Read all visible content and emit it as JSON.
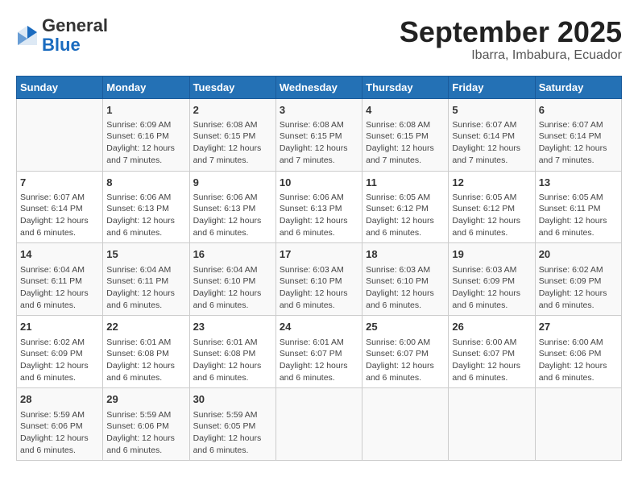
{
  "header": {
    "logo_general": "General",
    "logo_blue": "Blue",
    "month": "September 2025",
    "location": "Ibarra, Imbabura, Ecuador"
  },
  "days_of_week": [
    "Sunday",
    "Monday",
    "Tuesday",
    "Wednesday",
    "Thursday",
    "Friday",
    "Saturday"
  ],
  "weeks": [
    [
      {
        "day": "",
        "info": ""
      },
      {
        "day": "1",
        "info": "Sunrise: 6:09 AM\nSunset: 6:16 PM\nDaylight: 12 hours\nand 7 minutes."
      },
      {
        "day": "2",
        "info": "Sunrise: 6:08 AM\nSunset: 6:15 PM\nDaylight: 12 hours\nand 7 minutes."
      },
      {
        "day": "3",
        "info": "Sunrise: 6:08 AM\nSunset: 6:15 PM\nDaylight: 12 hours\nand 7 minutes."
      },
      {
        "day": "4",
        "info": "Sunrise: 6:08 AM\nSunset: 6:15 PM\nDaylight: 12 hours\nand 7 minutes."
      },
      {
        "day": "5",
        "info": "Sunrise: 6:07 AM\nSunset: 6:14 PM\nDaylight: 12 hours\nand 7 minutes."
      },
      {
        "day": "6",
        "info": "Sunrise: 6:07 AM\nSunset: 6:14 PM\nDaylight: 12 hours\nand 7 minutes."
      }
    ],
    [
      {
        "day": "7",
        "info": "Sunrise: 6:07 AM\nSunset: 6:14 PM\nDaylight: 12 hours\nand 6 minutes."
      },
      {
        "day": "8",
        "info": "Sunrise: 6:06 AM\nSunset: 6:13 PM\nDaylight: 12 hours\nand 6 minutes."
      },
      {
        "day": "9",
        "info": "Sunrise: 6:06 AM\nSunset: 6:13 PM\nDaylight: 12 hours\nand 6 minutes."
      },
      {
        "day": "10",
        "info": "Sunrise: 6:06 AM\nSunset: 6:13 PM\nDaylight: 12 hours\nand 6 minutes."
      },
      {
        "day": "11",
        "info": "Sunrise: 6:05 AM\nSunset: 6:12 PM\nDaylight: 12 hours\nand 6 minutes."
      },
      {
        "day": "12",
        "info": "Sunrise: 6:05 AM\nSunset: 6:12 PM\nDaylight: 12 hours\nand 6 minutes."
      },
      {
        "day": "13",
        "info": "Sunrise: 6:05 AM\nSunset: 6:11 PM\nDaylight: 12 hours\nand 6 minutes."
      }
    ],
    [
      {
        "day": "14",
        "info": "Sunrise: 6:04 AM\nSunset: 6:11 PM\nDaylight: 12 hours\nand 6 minutes."
      },
      {
        "day": "15",
        "info": "Sunrise: 6:04 AM\nSunset: 6:11 PM\nDaylight: 12 hours\nand 6 minutes."
      },
      {
        "day": "16",
        "info": "Sunrise: 6:04 AM\nSunset: 6:10 PM\nDaylight: 12 hours\nand 6 minutes."
      },
      {
        "day": "17",
        "info": "Sunrise: 6:03 AM\nSunset: 6:10 PM\nDaylight: 12 hours\nand 6 minutes."
      },
      {
        "day": "18",
        "info": "Sunrise: 6:03 AM\nSunset: 6:10 PM\nDaylight: 12 hours\nand 6 minutes."
      },
      {
        "day": "19",
        "info": "Sunrise: 6:03 AM\nSunset: 6:09 PM\nDaylight: 12 hours\nand 6 minutes."
      },
      {
        "day": "20",
        "info": "Sunrise: 6:02 AM\nSunset: 6:09 PM\nDaylight: 12 hours\nand 6 minutes."
      }
    ],
    [
      {
        "day": "21",
        "info": "Sunrise: 6:02 AM\nSunset: 6:09 PM\nDaylight: 12 hours\nand 6 minutes."
      },
      {
        "day": "22",
        "info": "Sunrise: 6:01 AM\nSunset: 6:08 PM\nDaylight: 12 hours\nand 6 minutes."
      },
      {
        "day": "23",
        "info": "Sunrise: 6:01 AM\nSunset: 6:08 PM\nDaylight: 12 hours\nand 6 minutes."
      },
      {
        "day": "24",
        "info": "Sunrise: 6:01 AM\nSunset: 6:07 PM\nDaylight: 12 hours\nand 6 minutes."
      },
      {
        "day": "25",
        "info": "Sunrise: 6:00 AM\nSunset: 6:07 PM\nDaylight: 12 hours\nand 6 minutes."
      },
      {
        "day": "26",
        "info": "Sunrise: 6:00 AM\nSunset: 6:07 PM\nDaylight: 12 hours\nand 6 minutes."
      },
      {
        "day": "27",
        "info": "Sunrise: 6:00 AM\nSunset: 6:06 PM\nDaylight: 12 hours\nand 6 minutes."
      }
    ],
    [
      {
        "day": "28",
        "info": "Sunrise: 5:59 AM\nSunset: 6:06 PM\nDaylight: 12 hours\nand 6 minutes."
      },
      {
        "day": "29",
        "info": "Sunrise: 5:59 AM\nSunset: 6:06 PM\nDaylight: 12 hours\nand 6 minutes."
      },
      {
        "day": "30",
        "info": "Sunrise: 5:59 AM\nSunset: 6:05 PM\nDaylight: 12 hours\nand 6 minutes."
      },
      {
        "day": "",
        "info": ""
      },
      {
        "day": "",
        "info": ""
      },
      {
        "day": "",
        "info": ""
      },
      {
        "day": "",
        "info": ""
      }
    ]
  ]
}
